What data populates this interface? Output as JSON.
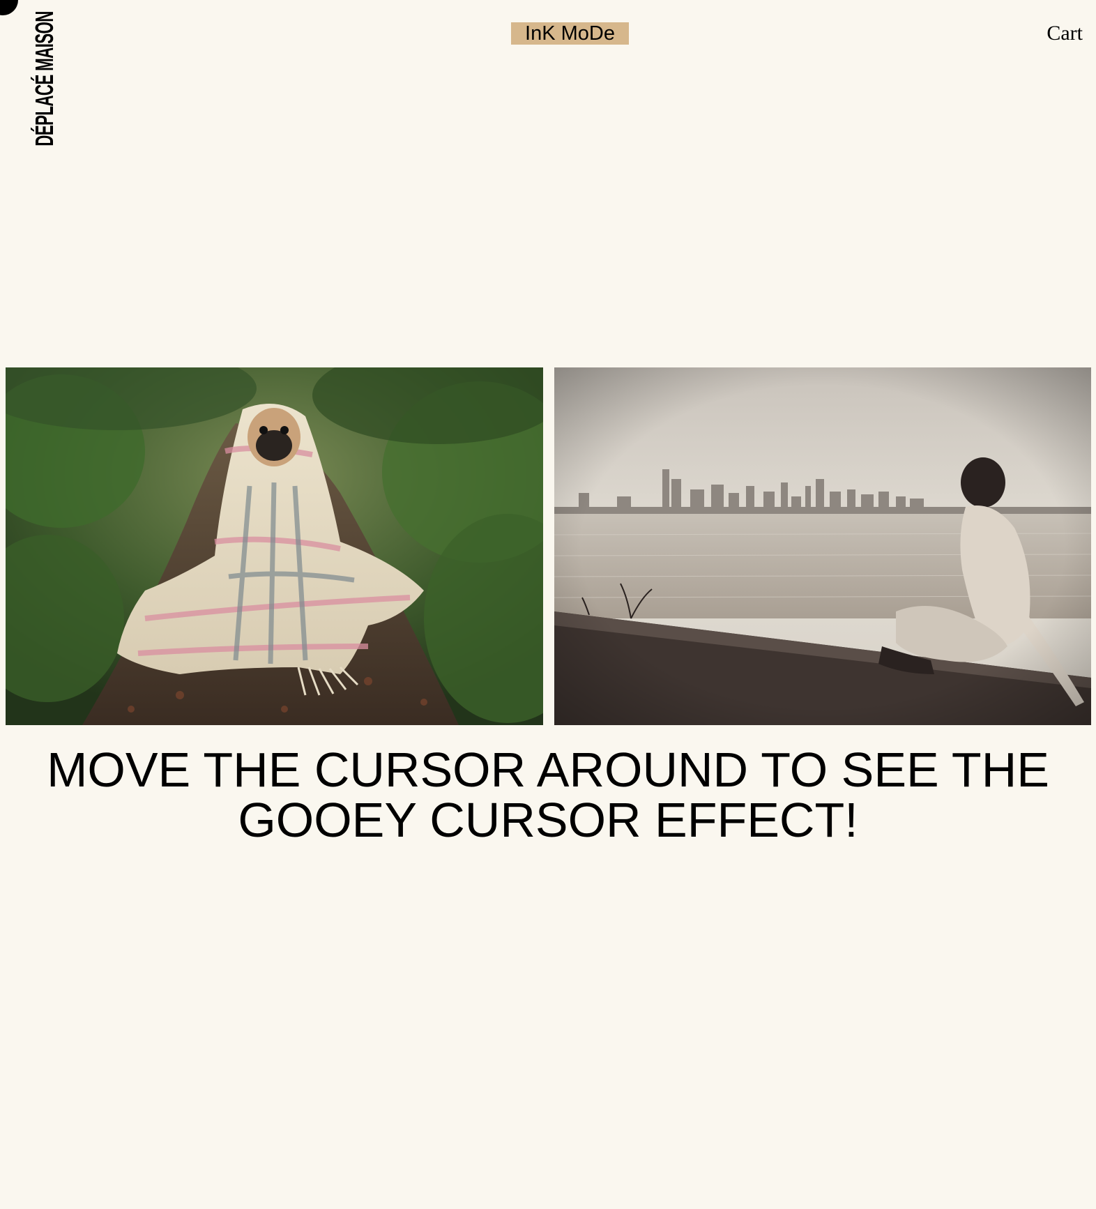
{
  "brand": {
    "name": "DÉPLACÉ MAISON"
  },
  "header": {
    "ink_mode_label": "InK MoDe",
    "cart_label": "Cart",
    "accent_color": "#d6b78c"
  },
  "gallery": {
    "images": [
      {
        "subject": "pug wrapped in plaid blanket on forest path"
      },
      {
        "subject": "person sitting on seawall looking at city skyline"
      }
    ]
  },
  "main": {
    "headline": "MOVE THE CURSOR AROUND TO SEE THE GOOEY CURSOR EFFECT!"
  },
  "colors": {
    "background": "#faf7ef",
    "text": "#000000"
  }
}
